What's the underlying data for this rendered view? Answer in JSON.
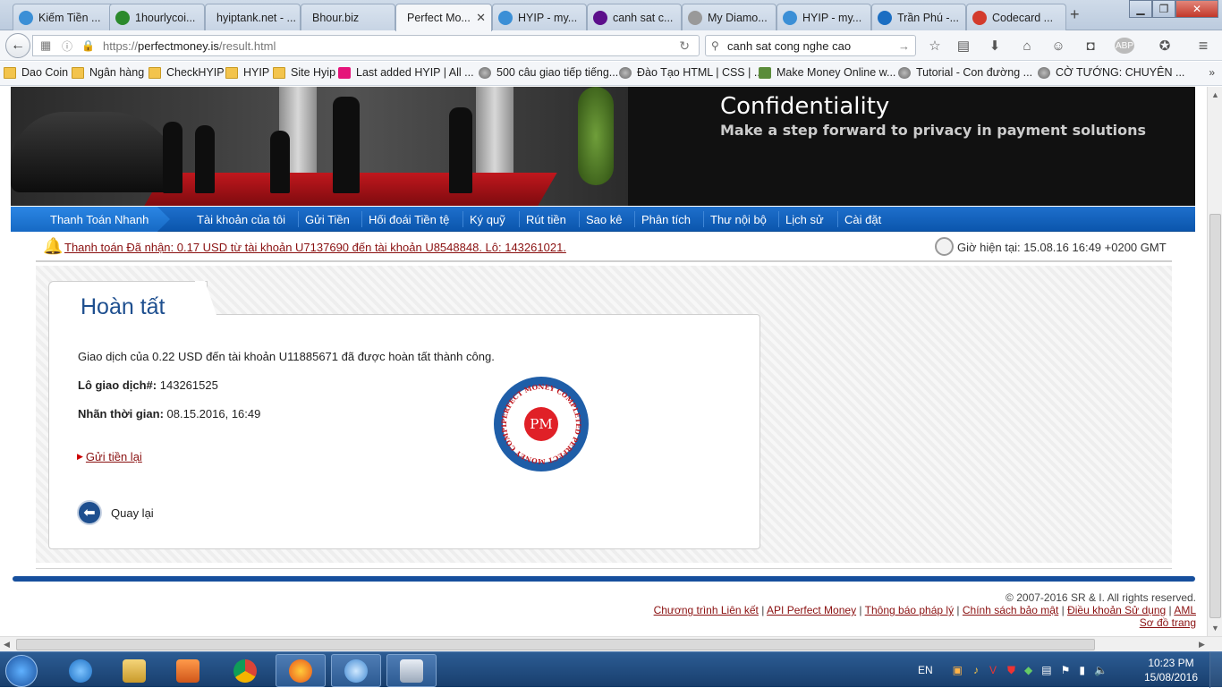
{
  "browser": {
    "tabs": [
      {
        "label": "Kiếm Tiền ...",
        "icon": "hyip-icon",
        "color": "#3b8fd6"
      },
      {
        "label": "1hourlycoi...",
        "icon": "coin-icon",
        "color": "#2c8a2c"
      },
      {
        "label": "hyiptank.net - ...",
        "icon": "blank-icon",
        "color": "#c7d4e4"
      },
      {
        "label": "Bhour.biz",
        "icon": "blank-icon",
        "color": "#c7d4e4"
      },
      {
        "label": "Perfect Mo...",
        "icon": "blank-icon",
        "color": "#f4f6f9"
      },
      {
        "label": "HYIP - my...",
        "icon": "hyip-icon",
        "color": "#3b8fd6"
      },
      {
        "label": "canh sat c...",
        "icon": "yahoo-icon",
        "color": "#5c0f8b"
      },
      {
        "label": "My Diamo...",
        "icon": "gear-icon",
        "color": "#999999"
      },
      {
        "label": "HYIP - my...",
        "icon": "hyip-icon",
        "color": "#3b8fd6"
      },
      {
        "label": "Trần Phú -...",
        "icon": "cc-icon",
        "color": "#1b6ec2"
      },
      {
        "label": "Codecard ...",
        "icon": "gmail-icon",
        "color": "#d33b2c"
      }
    ],
    "url_scheme": "https://",
    "url_host": "perfectmoney.is",
    "url_path": "/result.html",
    "search_value": "canh sat cong nghe cao",
    "bookmarks": [
      {
        "label": "Dao Coin",
        "icon": "folder-icon"
      },
      {
        "label": "Ngân hàng",
        "icon": "folder-icon"
      },
      {
        "label": "CheckHYIP",
        "icon": "folder-icon"
      },
      {
        "label": "HYIP",
        "icon": "folder-icon"
      },
      {
        "label": "Site Hyip",
        "icon": "folder-icon"
      },
      {
        "label": "Last added HYIP | All ...",
        "icon": "a-icon"
      },
      {
        "label": "500 câu giao tiếp tiếng...",
        "icon": "globe-icon"
      },
      {
        "label": "Đào Tạo HTML | CSS | ...",
        "icon": "globe-icon"
      },
      {
        "label": "Make Money Online w...",
        "icon": "money-icon"
      },
      {
        "label": "Tutorial - Con đường ...",
        "icon": "globe-icon"
      },
      {
        "label": "CỜ TƯỚNG: CHUYÊN ...",
        "icon": "globe-icon"
      }
    ]
  },
  "banner": {
    "title": "Confidentiality",
    "subtitle": "Make a step forward to privacy in payment solutions"
  },
  "menu": {
    "first": "Thanh Toán Nhanh",
    "items": [
      "Tài khoản của tôi",
      "Gửi Tiền",
      "Hối đoái Tiền tệ",
      "Ký quỹ",
      "Rút tiền",
      "Sao kê",
      "Phân tích",
      "Thư nội bộ",
      "Lịch sử",
      "Cài đặt"
    ]
  },
  "notice": {
    "message": "Thanh toán Đã nhận: 0.17 USD từ tài khoản U7137690 đến tài khoản U8548848. Lô: 143261021.",
    "time": "Giờ hiện tại: 15.08.16 16:49 +0200 GMT"
  },
  "result": {
    "title": "Hoàn tất",
    "description": "Giao dịch của 0.22 USD đến tài khoản U11885671 đã được hoàn tất thành công.",
    "batch_label": "Lô giao dịch#:",
    "batch_value": "143261525",
    "time_label": "Nhãn thời gian:",
    "time_value": "08.15.2016, 16:49",
    "resend_label": "Gửi tiền lại",
    "back_label": "Quay lại",
    "stamp_center": "PM",
    "stamp_ring_text": "PERFECT MONEY  COMPLETED  PERFECT MONEY  COMPLETED"
  },
  "footer": {
    "copyright": "© 2007-2016 SR & I. All rights reserved.",
    "links": [
      "Chương trình Liên kết",
      "API Perfect Money",
      "Thông báo pháp lý",
      "Chính sách bảo mật",
      "Điều khoản Sử dụng",
      "AML",
      "Sơ đồ trang"
    ]
  },
  "taskbar": {
    "language": "EN",
    "time": "10:23 PM",
    "date": "15/08/2016"
  },
  "colors": {
    "brand_blue": "#1e4f8f",
    "menu_blue": "#0b56ad",
    "link_red": "#8a1010"
  }
}
